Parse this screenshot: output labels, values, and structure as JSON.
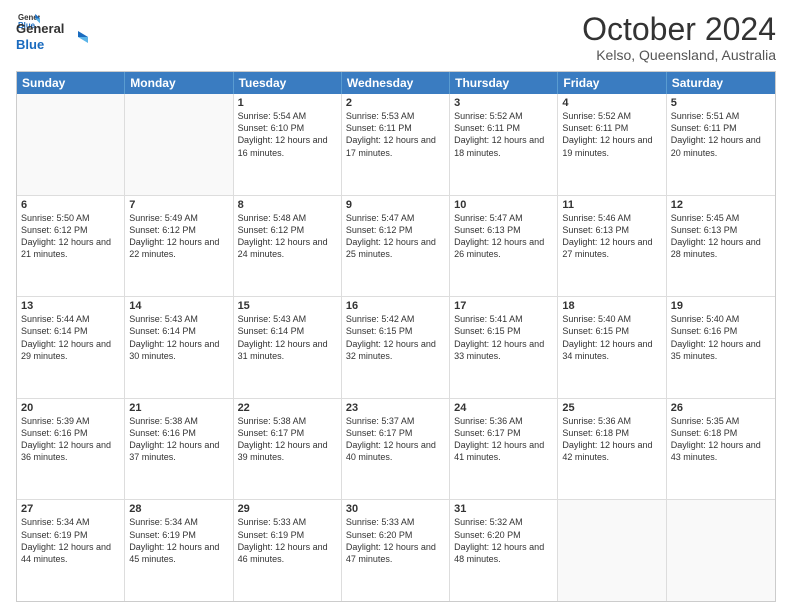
{
  "logo": {
    "line1": "General",
    "line2": "Blue"
  },
  "title": "October 2024",
  "location": "Kelso, Queensland, Australia",
  "days_header": [
    "Sunday",
    "Monday",
    "Tuesday",
    "Wednesday",
    "Thursday",
    "Friday",
    "Saturday"
  ],
  "rows": [
    [
      {
        "day": "",
        "info": "",
        "empty": true
      },
      {
        "day": "",
        "info": "",
        "empty": true
      },
      {
        "day": "1",
        "info": "Sunrise: 5:54 AM\nSunset: 6:10 PM\nDaylight: 12 hours and 16 minutes."
      },
      {
        "day": "2",
        "info": "Sunrise: 5:53 AM\nSunset: 6:11 PM\nDaylight: 12 hours and 17 minutes."
      },
      {
        "day": "3",
        "info": "Sunrise: 5:52 AM\nSunset: 6:11 PM\nDaylight: 12 hours and 18 minutes."
      },
      {
        "day": "4",
        "info": "Sunrise: 5:52 AM\nSunset: 6:11 PM\nDaylight: 12 hours and 19 minutes."
      },
      {
        "day": "5",
        "info": "Sunrise: 5:51 AM\nSunset: 6:11 PM\nDaylight: 12 hours and 20 minutes."
      }
    ],
    [
      {
        "day": "6",
        "info": "Sunrise: 5:50 AM\nSunset: 6:12 PM\nDaylight: 12 hours and 21 minutes."
      },
      {
        "day": "7",
        "info": "Sunrise: 5:49 AM\nSunset: 6:12 PM\nDaylight: 12 hours and 22 minutes."
      },
      {
        "day": "8",
        "info": "Sunrise: 5:48 AM\nSunset: 6:12 PM\nDaylight: 12 hours and 24 minutes."
      },
      {
        "day": "9",
        "info": "Sunrise: 5:47 AM\nSunset: 6:12 PM\nDaylight: 12 hours and 25 minutes."
      },
      {
        "day": "10",
        "info": "Sunrise: 5:47 AM\nSunset: 6:13 PM\nDaylight: 12 hours and 26 minutes."
      },
      {
        "day": "11",
        "info": "Sunrise: 5:46 AM\nSunset: 6:13 PM\nDaylight: 12 hours and 27 minutes."
      },
      {
        "day": "12",
        "info": "Sunrise: 5:45 AM\nSunset: 6:13 PM\nDaylight: 12 hours and 28 minutes."
      }
    ],
    [
      {
        "day": "13",
        "info": "Sunrise: 5:44 AM\nSunset: 6:14 PM\nDaylight: 12 hours and 29 minutes."
      },
      {
        "day": "14",
        "info": "Sunrise: 5:43 AM\nSunset: 6:14 PM\nDaylight: 12 hours and 30 minutes."
      },
      {
        "day": "15",
        "info": "Sunrise: 5:43 AM\nSunset: 6:14 PM\nDaylight: 12 hours and 31 minutes."
      },
      {
        "day": "16",
        "info": "Sunrise: 5:42 AM\nSunset: 6:15 PM\nDaylight: 12 hours and 32 minutes."
      },
      {
        "day": "17",
        "info": "Sunrise: 5:41 AM\nSunset: 6:15 PM\nDaylight: 12 hours and 33 minutes."
      },
      {
        "day": "18",
        "info": "Sunrise: 5:40 AM\nSunset: 6:15 PM\nDaylight: 12 hours and 34 minutes."
      },
      {
        "day": "19",
        "info": "Sunrise: 5:40 AM\nSunset: 6:16 PM\nDaylight: 12 hours and 35 minutes."
      }
    ],
    [
      {
        "day": "20",
        "info": "Sunrise: 5:39 AM\nSunset: 6:16 PM\nDaylight: 12 hours and 36 minutes."
      },
      {
        "day": "21",
        "info": "Sunrise: 5:38 AM\nSunset: 6:16 PM\nDaylight: 12 hours and 37 minutes."
      },
      {
        "day": "22",
        "info": "Sunrise: 5:38 AM\nSunset: 6:17 PM\nDaylight: 12 hours and 39 minutes."
      },
      {
        "day": "23",
        "info": "Sunrise: 5:37 AM\nSunset: 6:17 PM\nDaylight: 12 hours and 40 minutes."
      },
      {
        "day": "24",
        "info": "Sunrise: 5:36 AM\nSunset: 6:17 PM\nDaylight: 12 hours and 41 minutes."
      },
      {
        "day": "25",
        "info": "Sunrise: 5:36 AM\nSunset: 6:18 PM\nDaylight: 12 hours and 42 minutes."
      },
      {
        "day": "26",
        "info": "Sunrise: 5:35 AM\nSunset: 6:18 PM\nDaylight: 12 hours and 43 minutes."
      }
    ],
    [
      {
        "day": "27",
        "info": "Sunrise: 5:34 AM\nSunset: 6:19 PM\nDaylight: 12 hours and 44 minutes."
      },
      {
        "day": "28",
        "info": "Sunrise: 5:34 AM\nSunset: 6:19 PM\nDaylight: 12 hours and 45 minutes."
      },
      {
        "day": "29",
        "info": "Sunrise: 5:33 AM\nSunset: 6:19 PM\nDaylight: 12 hours and 46 minutes."
      },
      {
        "day": "30",
        "info": "Sunrise: 5:33 AM\nSunset: 6:20 PM\nDaylight: 12 hours and 47 minutes."
      },
      {
        "day": "31",
        "info": "Sunrise: 5:32 AM\nSunset: 6:20 PM\nDaylight: 12 hours and 48 minutes."
      },
      {
        "day": "",
        "info": "",
        "empty": true
      },
      {
        "day": "",
        "info": "",
        "empty": true
      }
    ]
  ]
}
